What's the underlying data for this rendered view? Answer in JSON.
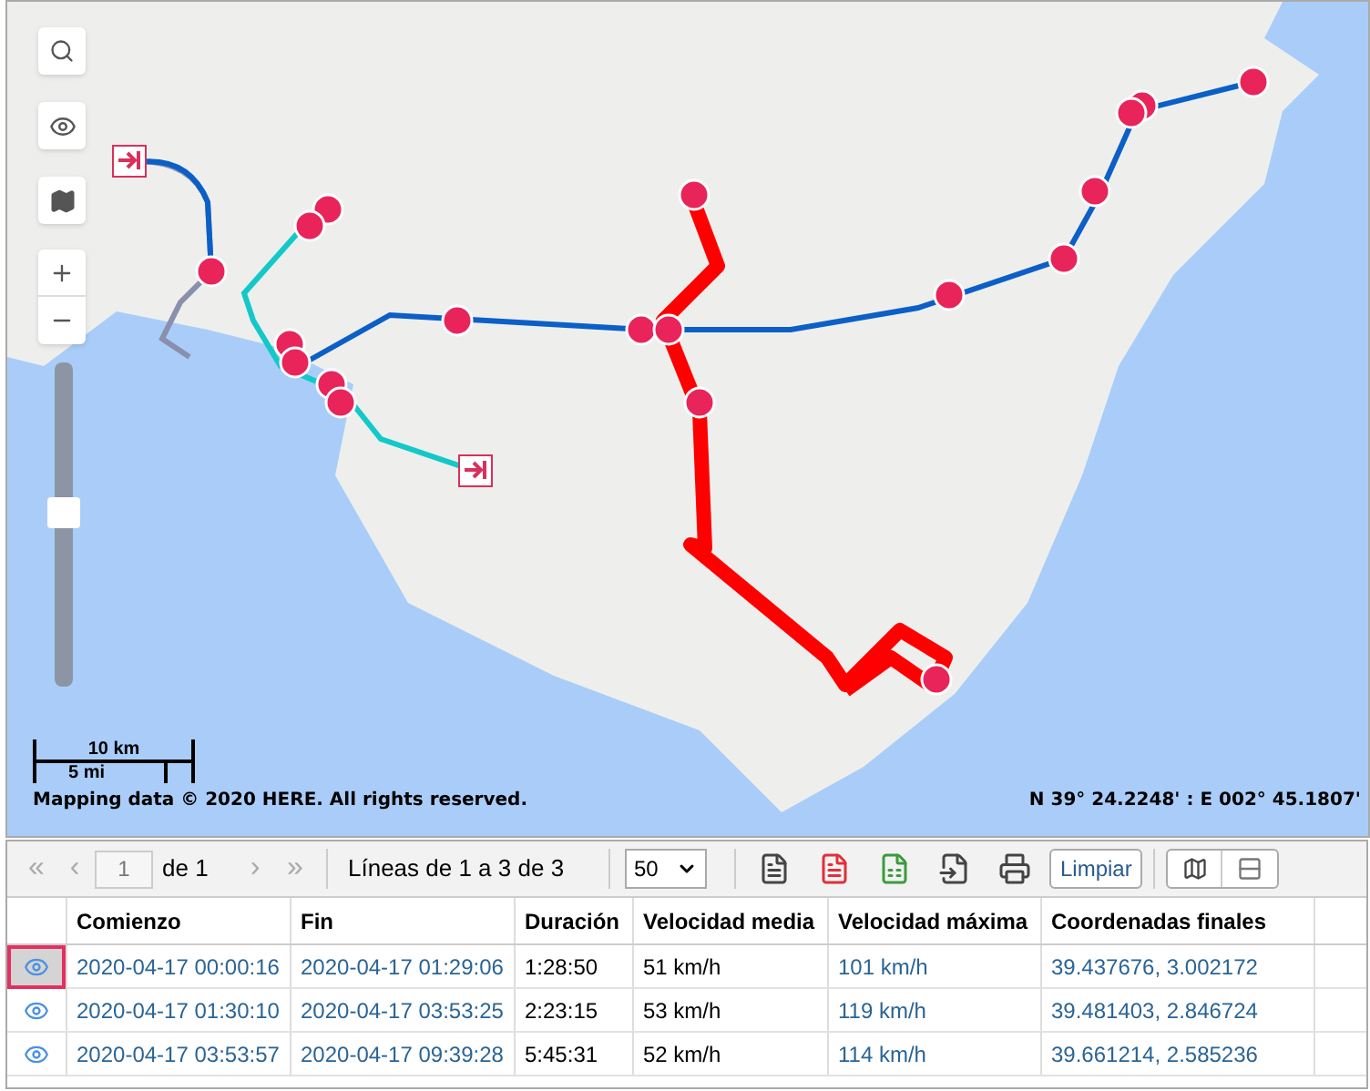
{
  "map": {
    "zoom_slider": {
      "level": 0.54
    },
    "scale": {
      "km": "10 km",
      "mi": "5 mi"
    },
    "attribution": "Mapping data © 2020 HERE. All rights reserved.",
    "coordinates": "N 39° 24.2248' : E 002° 45.1807'"
  },
  "toolbar": {
    "first": "«",
    "prev": "‹",
    "page": "1",
    "page_of": "de 1",
    "next": "›",
    "last": "»",
    "lines": "Líneas de 1 a 3 de 3",
    "page_size": "50",
    "clear": "Limpiar"
  },
  "table": {
    "columns": [
      "Comienzo",
      "Fin",
      "Duración",
      "Velocidad media",
      "Velocidad máxima",
      "Coordenadas finales"
    ],
    "rows": [
      {
        "selected": true,
        "cells": [
          "2020-04-17 00:00:16",
          "2020-04-17 01:29:06",
          "1:28:50",
          "51 km/h",
          "101 km/h",
          "39.437676, 3.002172"
        ]
      },
      {
        "selected": false,
        "cells": [
          "2020-04-17 01:30:10",
          "2020-04-17 03:53:25",
          "2:23:15",
          "53 km/h",
          "119 km/h",
          "39.481403, 2.846724"
        ]
      },
      {
        "selected": false,
        "cells": [
          "2020-04-17 03:53:57",
          "2020-04-17 09:39:28",
          "5:45:31",
          "52 km/h",
          "114 km/h",
          "39.661214, 2.585236"
        ]
      }
    ]
  }
}
